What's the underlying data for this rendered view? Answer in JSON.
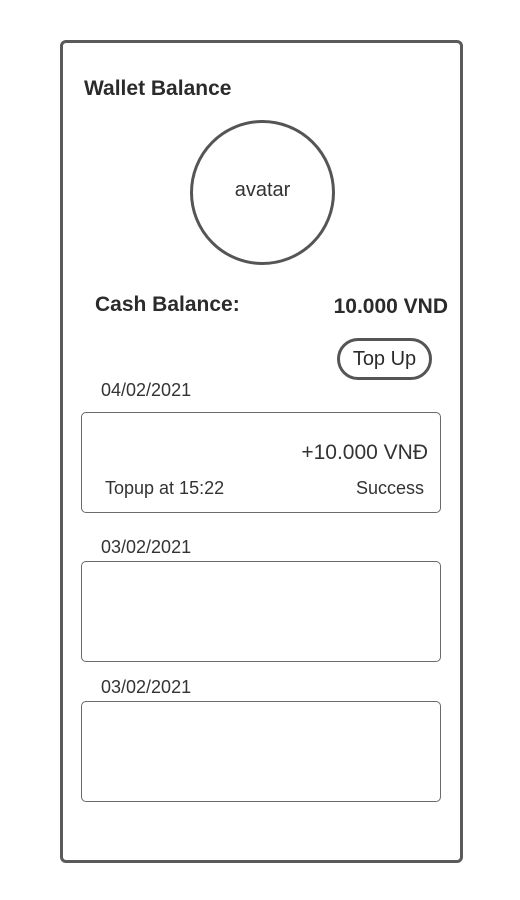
{
  "header": {
    "title": "Wallet Balance"
  },
  "profile": {
    "avatar_label": "avatar"
  },
  "balance": {
    "label": "Cash Balance:",
    "value": "10.000 VND"
  },
  "actions": {
    "topup_label": "Top Up"
  },
  "transactions": [
    {
      "date": "04/02/2021",
      "amount": "+10.000 VNĐ",
      "description": "Topup at 15:22",
      "status": "Success"
    },
    {
      "date": "03/02/2021",
      "amount": "",
      "description": "",
      "status": ""
    },
    {
      "date": "03/02/2021",
      "amount": "",
      "description": "",
      "status": ""
    }
  ]
}
